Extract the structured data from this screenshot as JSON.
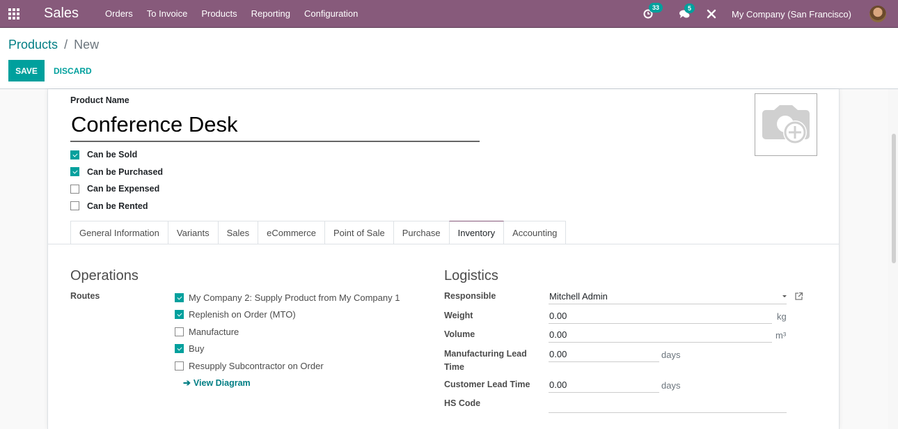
{
  "navbar": {
    "app_name": "Sales",
    "menu": [
      "Orders",
      "To Invoice",
      "Products",
      "Reporting",
      "Configuration"
    ],
    "activity_count": "33",
    "messages_count": "5",
    "company": "My Company (San Francisco)",
    "icons": {
      "apps": "apps-grid-icon",
      "activity": "clock-icon",
      "messages": "chat-icon",
      "debug": "tools-icon"
    }
  },
  "breadcrumb": {
    "parent": "Products",
    "separator": "/",
    "current": "New"
  },
  "actions": {
    "save": "SAVE",
    "discard": "DISCARD"
  },
  "product": {
    "name_label": "Product Name",
    "name_value": "Conference Desk",
    "options": [
      {
        "label": "Can be Sold",
        "checked": true
      },
      {
        "label": "Can be Purchased",
        "checked": true
      },
      {
        "label": "Can be Expensed",
        "checked": false
      },
      {
        "label": "Can be Rented",
        "checked": false
      }
    ]
  },
  "tabs": [
    {
      "label": "General Information",
      "active": false
    },
    {
      "label": "Variants",
      "active": false
    },
    {
      "label": "Sales",
      "active": false
    },
    {
      "label": "eCommerce",
      "active": false
    },
    {
      "label": "Point of Sale",
      "active": false
    },
    {
      "label": "Purchase",
      "active": false
    },
    {
      "label": "Inventory",
      "active": true
    },
    {
      "label": "Accounting",
      "active": false
    }
  ],
  "operations": {
    "title": "Operations",
    "routes_label": "Routes",
    "routes": [
      {
        "label": "My Company 2: Supply Product from My Company 1",
        "checked": true
      },
      {
        "label": "Replenish on Order (MTO)",
        "checked": true
      },
      {
        "label": "Manufacture",
        "checked": false
      },
      {
        "label": "Buy",
        "checked": true
      },
      {
        "label": "Resupply Subcontractor on Order",
        "checked": false
      }
    ],
    "view_diagram": "View Diagram"
  },
  "logistics": {
    "title": "Logistics",
    "responsible_label": "Responsible",
    "responsible_value": "Mitchell Admin",
    "weight_label": "Weight",
    "weight_value": "0.00",
    "weight_unit": "kg",
    "volume_label": "Volume",
    "volume_value": "0.00",
    "volume_unit": "m³",
    "mfg_lead_label_1": "Manufacturing Lead",
    "mfg_lead_label_2": "Time",
    "mfg_lead_value": "0.00",
    "mfg_lead_unit": "days",
    "customer_lead_label": "Customer Lead Time",
    "customer_lead_value": "0.00",
    "customer_lead_unit": "days",
    "hs_code_label": "HS Code",
    "hs_code_value": ""
  }
}
